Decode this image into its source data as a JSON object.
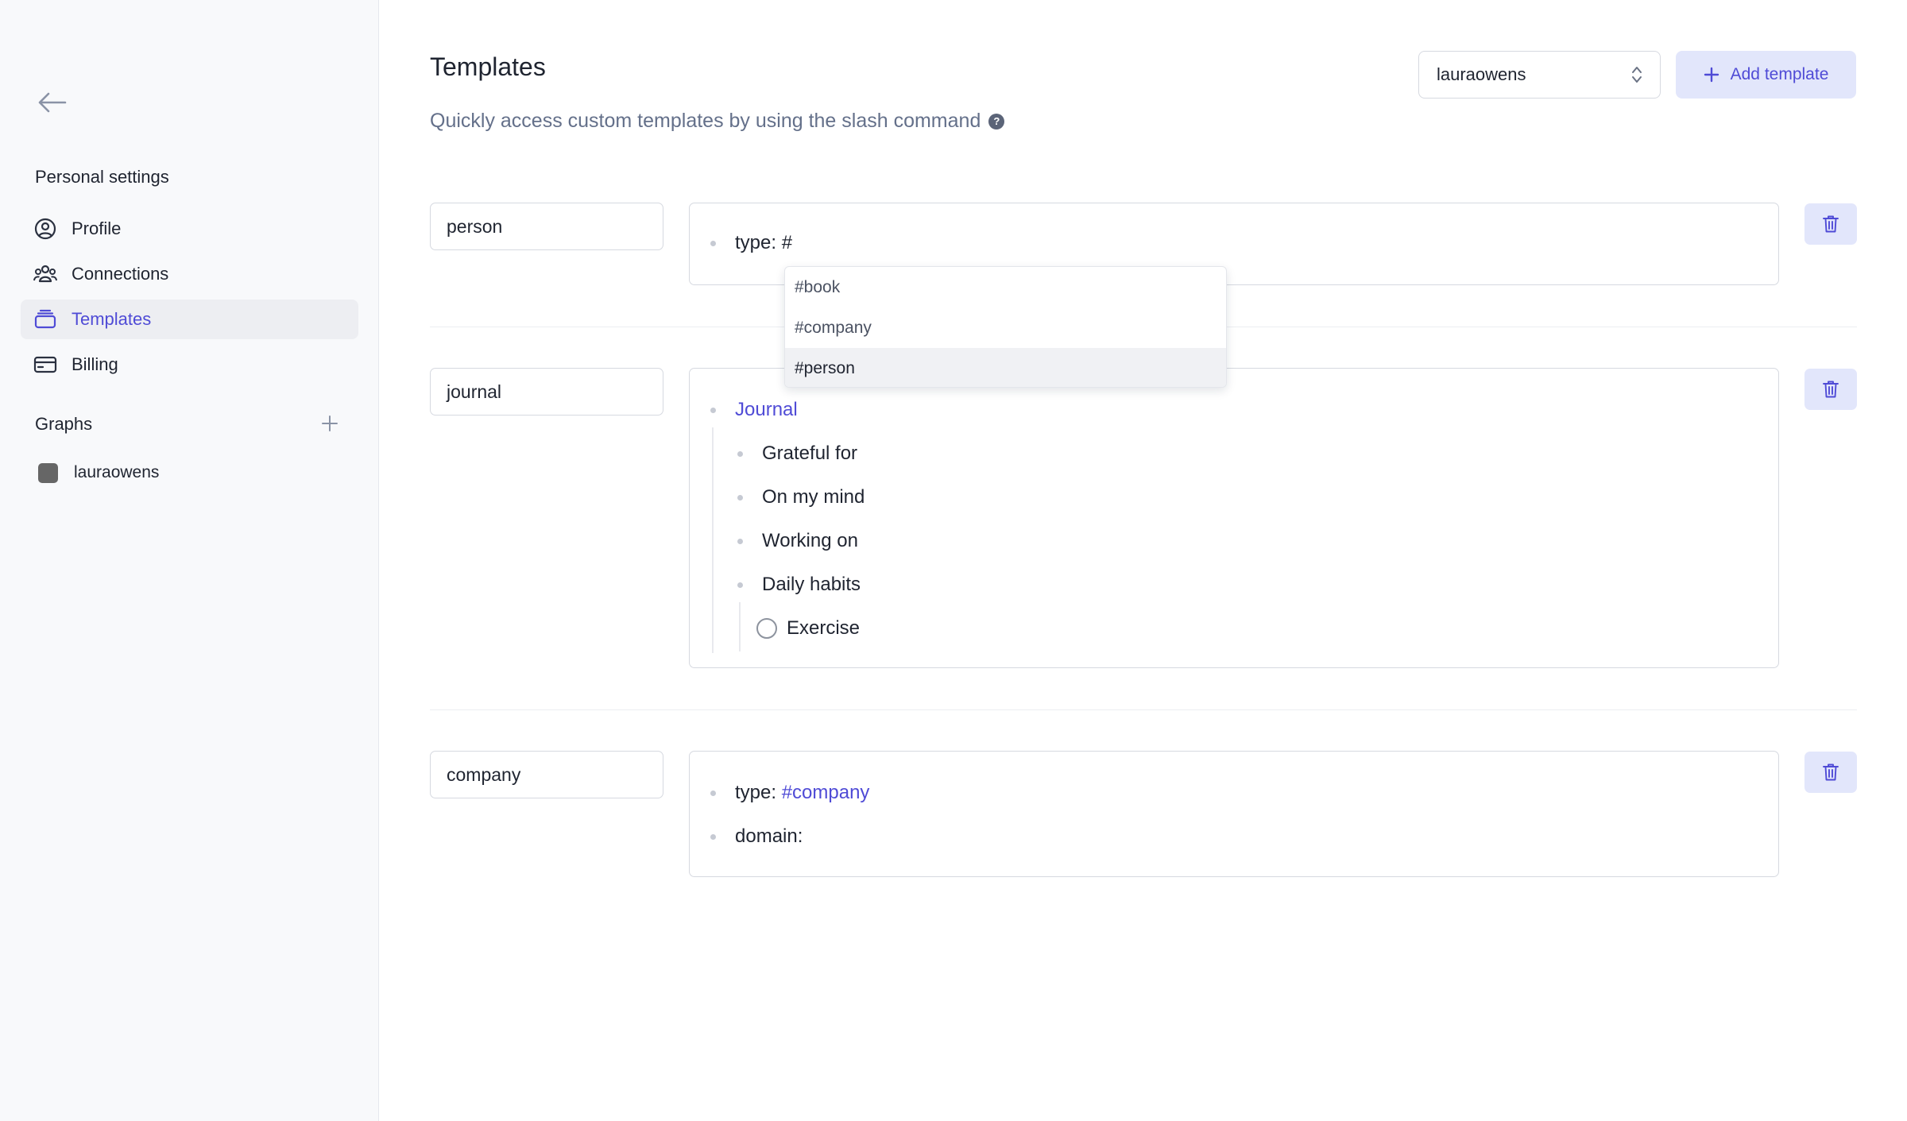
{
  "sidebar": {
    "section_title": "Personal settings",
    "nav": [
      {
        "label": "Profile",
        "icon": "user-circle-icon",
        "active": false
      },
      {
        "label": "Connections",
        "icon": "users-icon",
        "active": false
      },
      {
        "label": "Templates",
        "icon": "template-icon",
        "active": true
      },
      {
        "label": "Billing",
        "icon": "credit-card-icon",
        "active": false
      }
    ],
    "graphs_title": "Graphs",
    "graphs": [
      {
        "name": "lauraowens",
        "color": "#666666"
      }
    ]
  },
  "header": {
    "title": "Templates",
    "subtitle": "Quickly access custom templates by using the slash command",
    "help_icon": "?",
    "graph_select": {
      "value": "lauraowens"
    },
    "add_button_label": "Add template"
  },
  "templates": [
    {
      "name": "person",
      "lines": [
        {
          "prefix": "type: #",
          "text": ""
        }
      ]
    },
    {
      "name": "journal",
      "lines": [
        {
          "text": "Journal",
          "link": true
        },
        {
          "text": "Grateful for"
        },
        {
          "text": "On my mind"
        },
        {
          "text": "Working on"
        },
        {
          "text": "Daily habits"
        },
        {
          "text": "Exercise",
          "checkbox": true,
          "checked": false
        }
      ]
    },
    {
      "name": "company",
      "lines": [
        {
          "prefix": "type: ",
          "tag": "#company"
        },
        {
          "prefix": "domain:"
        }
      ]
    }
  ],
  "autocomplete": {
    "items": [
      "#book",
      "#company",
      "#person"
    ],
    "selected": "#person"
  },
  "colors": {
    "accent": "#4f4bd6",
    "accent_bg": "#e2e6fb",
    "sidebar_bg": "#f8f9fb"
  }
}
